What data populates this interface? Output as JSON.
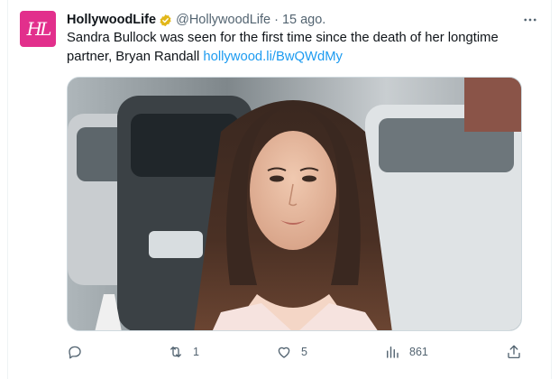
{
  "tweet": {
    "avatar_text": "HL",
    "display_name": "HollywoodLife",
    "handle": "@HollywoodLife",
    "separator": "·",
    "time": "15 ago.",
    "text": "Sandra Bullock was seen for the first time since the death of her longtime partner, Bryan Randall",
    "link": "hollywood.li/BwQWdMy",
    "media_icon": "photo-of-woman-with-long-dark-hair-in-street"
  },
  "actions": {
    "reply_count": "",
    "retweet_count": "1",
    "like_count": "5",
    "views_count": "861"
  },
  "colors": {
    "accent": "#1d9bf0",
    "brand": "#e22f8c",
    "verified": "#e2b719",
    "muted": "#536471"
  },
  "icons": [
    "verified-badge-icon",
    "more-icon",
    "reply-icon",
    "retweet-icon",
    "like-icon",
    "views-icon",
    "share-icon"
  ]
}
